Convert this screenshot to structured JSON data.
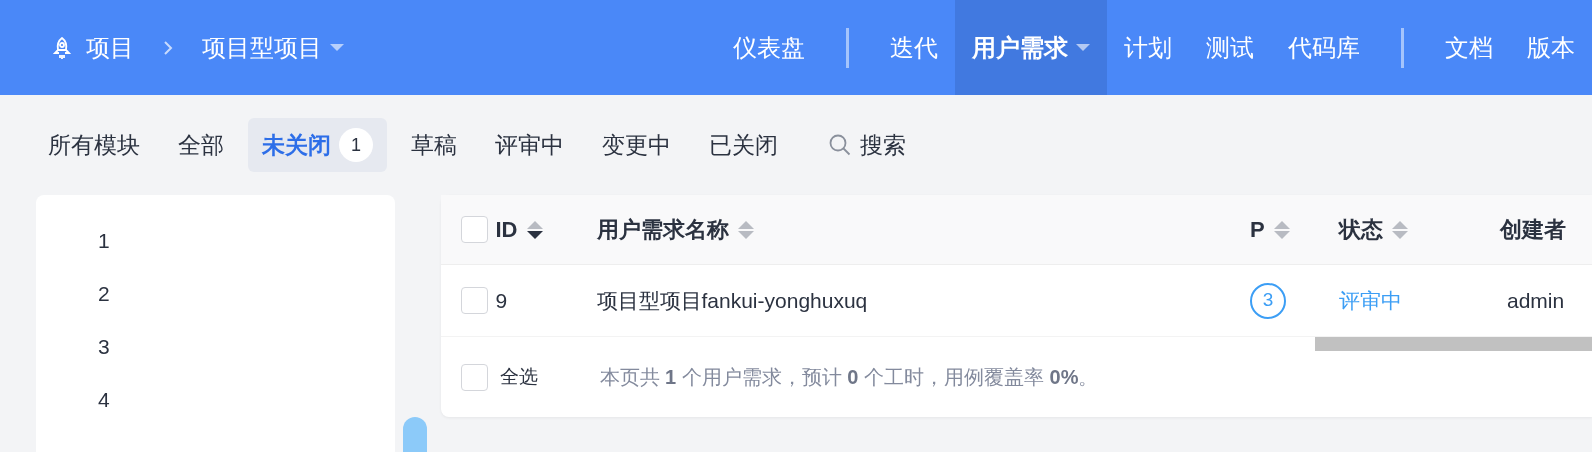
{
  "breadcrumb": {
    "root": "项目",
    "current": "项目型项目"
  },
  "nav_groups": [
    [
      {
        "label": "仪表盘",
        "selected": false,
        "has_menu": false
      }
    ],
    [
      {
        "label": "迭代",
        "selected": false,
        "has_menu": false
      },
      {
        "label": "用户需求",
        "selected": true,
        "has_menu": true
      },
      {
        "label": "计划",
        "selected": false,
        "has_menu": false
      },
      {
        "label": "测试",
        "selected": false,
        "has_menu": false
      },
      {
        "label": "代码库",
        "selected": false,
        "has_menu": false
      }
    ],
    [
      {
        "label": "文档",
        "selected": false,
        "has_menu": false
      },
      {
        "label": "版本",
        "selected": false,
        "has_menu": false
      }
    ]
  ],
  "module_filter": "所有模块",
  "filters": [
    {
      "label": "全部",
      "selected": false
    },
    {
      "label": "未关闭",
      "selected": true,
      "count": "1"
    },
    {
      "label": "草稿",
      "selected": false
    },
    {
      "label": "评审中",
      "selected": false
    },
    {
      "label": "变更中",
      "selected": false
    },
    {
      "label": "已关闭",
      "selected": false
    }
  ],
  "search": "搜索",
  "modules": [
    "1",
    "2",
    "3",
    "4"
  ],
  "table": {
    "columns": [
      {
        "label": "ID",
        "sort_desc": true,
        "checked": false
      },
      {
        "label": "用户需求名称",
        "sort_desc": false
      },
      {
        "label": "P",
        "sort_desc": false
      },
      {
        "label": "状态",
        "sort_desc": false
      },
      {
        "label": "创建者"
      }
    ],
    "rows": [
      {
        "checked": false,
        "id": "9",
        "name": "项目型项目fankui-yonghuxuq",
        "priority": "3",
        "status": "评审中",
        "creator": "admin"
      }
    ],
    "footer": {
      "select_all": "全选",
      "checked": false,
      "summary": "本页共 **1** 个用户需求，预计 **0** 个工时，用例覆盖率 **0%**。"
    }
  }
}
